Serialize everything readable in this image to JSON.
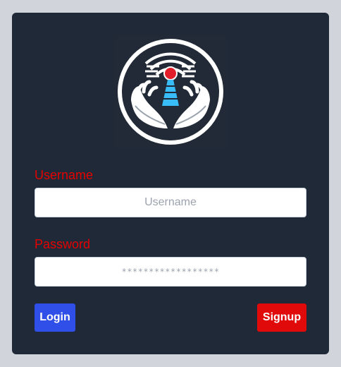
{
  "logo": {
    "icon": "radio-tower-hands-logo",
    "colors": {
      "ring": "#ffffff",
      "beacon": "#e11d2a",
      "tower": "#38bdf8",
      "background": "#212a36"
    }
  },
  "form": {
    "username": {
      "label": "Username",
      "placeholder": "Username",
      "value": ""
    },
    "password": {
      "label": "Password",
      "placeholder": "******************",
      "value": ""
    }
  },
  "buttons": {
    "login_label": "Login",
    "signup_label": "Signup"
  },
  "colors": {
    "page_bg": "#d1d5db",
    "card_bg": "#1f2937",
    "label": "#e50000",
    "login_btn": "#2f4fe8",
    "signup_btn": "#e10a0a"
  }
}
